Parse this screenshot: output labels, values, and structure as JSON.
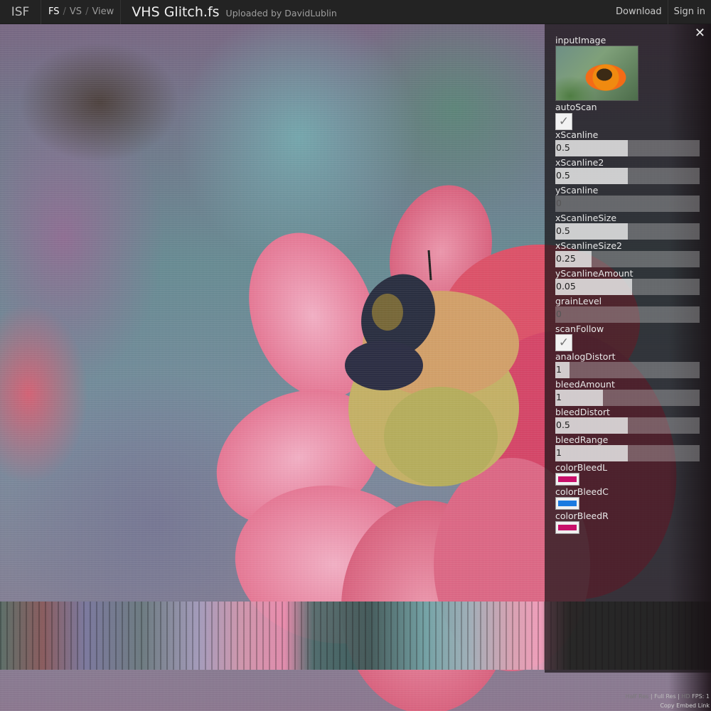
{
  "header": {
    "logo": "ISF",
    "modes": {
      "fs": "FS",
      "vs": "VS",
      "view": "View",
      "sep": "/"
    },
    "title": "VHS Glitch.fs",
    "uploader": "Uploaded by DavidLublin",
    "download": "Download",
    "sign_in": "Sign in"
  },
  "panel": {
    "close_glyph": "✕",
    "input_image_label": "inputImage",
    "check_glyph": "✓",
    "controls": [
      {
        "label": "autoScan",
        "type": "bool",
        "checked": true
      },
      {
        "label": "xScanline",
        "type": "float",
        "value": "0.5",
        "fraction": 0.5
      },
      {
        "label": "xScanline2",
        "type": "float",
        "value": "0.5",
        "fraction": 0.5
      },
      {
        "label": "yScanline",
        "type": "float",
        "value": "0",
        "fraction": 0.0
      },
      {
        "label": "xScanlineSize",
        "type": "float",
        "value": "0.5",
        "fraction": 0.5
      },
      {
        "label": "xScanlineSize2",
        "type": "float",
        "value": "0.25",
        "fraction": 0.25
      },
      {
        "label": "yScanlineAmount",
        "type": "float",
        "value": "0.05",
        "fraction": 0.53
      },
      {
        "label": "grainLevel",
        "type": "float",
        "value": "0",
        "fraction": 0.0
      },
      {
        "label": "scanFollow",
        "type": "bool",
        "checked": true
      },
      {
        "label": "analogDistort",
        "type": "float",
        "value": "1",
        "fraction": 0.1
      },
      {
        "label": "bleedAmount",
        "type": "float",
        "value": "1",
        "fraction": 0.33
      },
      {
        "label": "bleedDistort",
        "type": "float",
        "value": "0.5",
        "fraction": 0.5
      },
      {
        "label": "bleedRange",
        "type": "float",
        "value": "1",
        "fraction": 0.5
      }
    ],
    "colors": [
      {
        "label": "colorBleedL",
        "color": "#c8106a"
      },
      {
        "label": "colorBleedC",
        "color": "#1a7ae0"
      },
      {
        "label": "colorBleedR",
        "color": "#c8106a"
      }
    ]
  },
  "footer": {
    "half_res": "Half Res",
    "pipe": "|",
    "full_res": "Full Res",
    "hd": "HD",
    "fps": "FPS: 1",
    "embed": "Copy Embed Link"
  }
}
